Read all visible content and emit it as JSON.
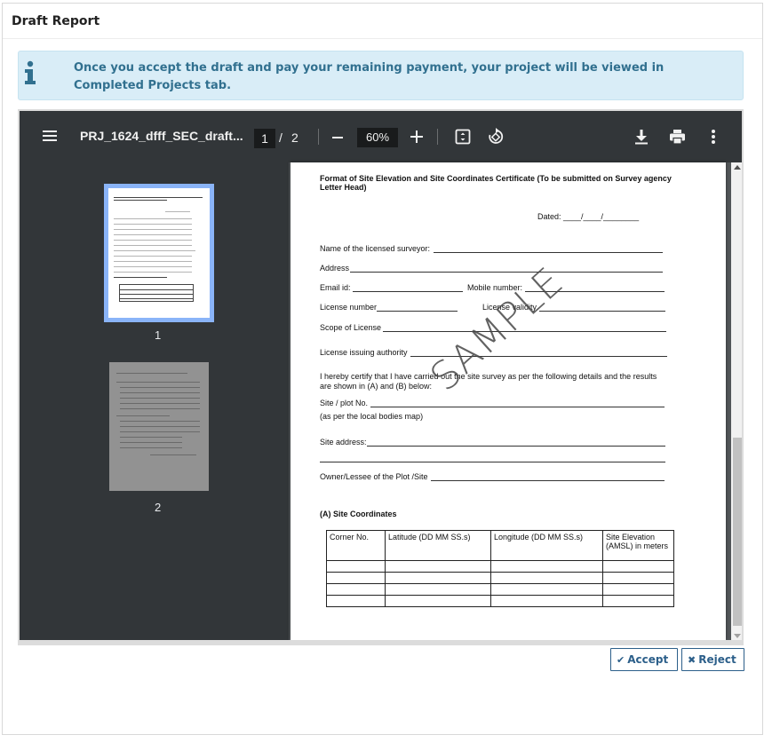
{
  "panel": {
    "title": "Draft Report"
  },
  "alert": {
    "icon": "info-icon",
    "message": "Once you accept the draft and pay your remaining payment, your project will be viewed in Completed Projects tab."
  },
  "viewer": {
    "filename": "PRJ_1624_dfff_SEC_draft...",
    "current_page": "1",
    "page_separator": "/",
    "total_pages": "2",
    "zoom": "60%",
    "thumbnails": [
      {
        "label": "1",
        "selected": true
      },
      {
        "label": "2",
        "selected": false
      }
    ]
  },
  "document": {
    "title_line1": "Format of Site Elevation and Site Coordinates Certificate (To be submitted on Survey agency",
    "title_line2": "Letter Head)",
    "dated": "Dated: ____/____/________",
    "fields": {
      "surveyor": "Name of the licensed surveyor:",
      "address": "Address",
      "email": "Email id:",
      "mobile": "Mobile number:",
      "license_number": "License number",
      "license_validity": "License validity",
      "scope": "Scope of License",
      "authority": "License issuing authority",
      "certify_line1": "I hereby certify that I have carried out the site survey as per the following details and the results",
      "certify_line2": "are shown in (A) and (B) below:",
      "plot_no": "Site / plot No.",
      "plot_note": "(as per the local bodies map)",
      "site_address": "Site address:",
      "owner": "Owner/Lessee of the Plot /Site"
    },
    "watermark": "SAMPLE",
    "section_a": "(A) Site Coordinates",
    "table_headers": [
      "Corner No.",
      "Latitude (DD MM SS.s)",
      "Longitude (DD MM SS.s)",
      "Site Elevation (AMSL) in meters"
    ]
  },
  "buttons": {
    "accept": "Accept",
    "reject": "Reject"
  },
  "colors": {
    "accent": "#2c5f8a",
    "alert_bg": "#d9edf7",
    "alert_text": "#31708f",
    "toolbar": "#323639"
  }
}
